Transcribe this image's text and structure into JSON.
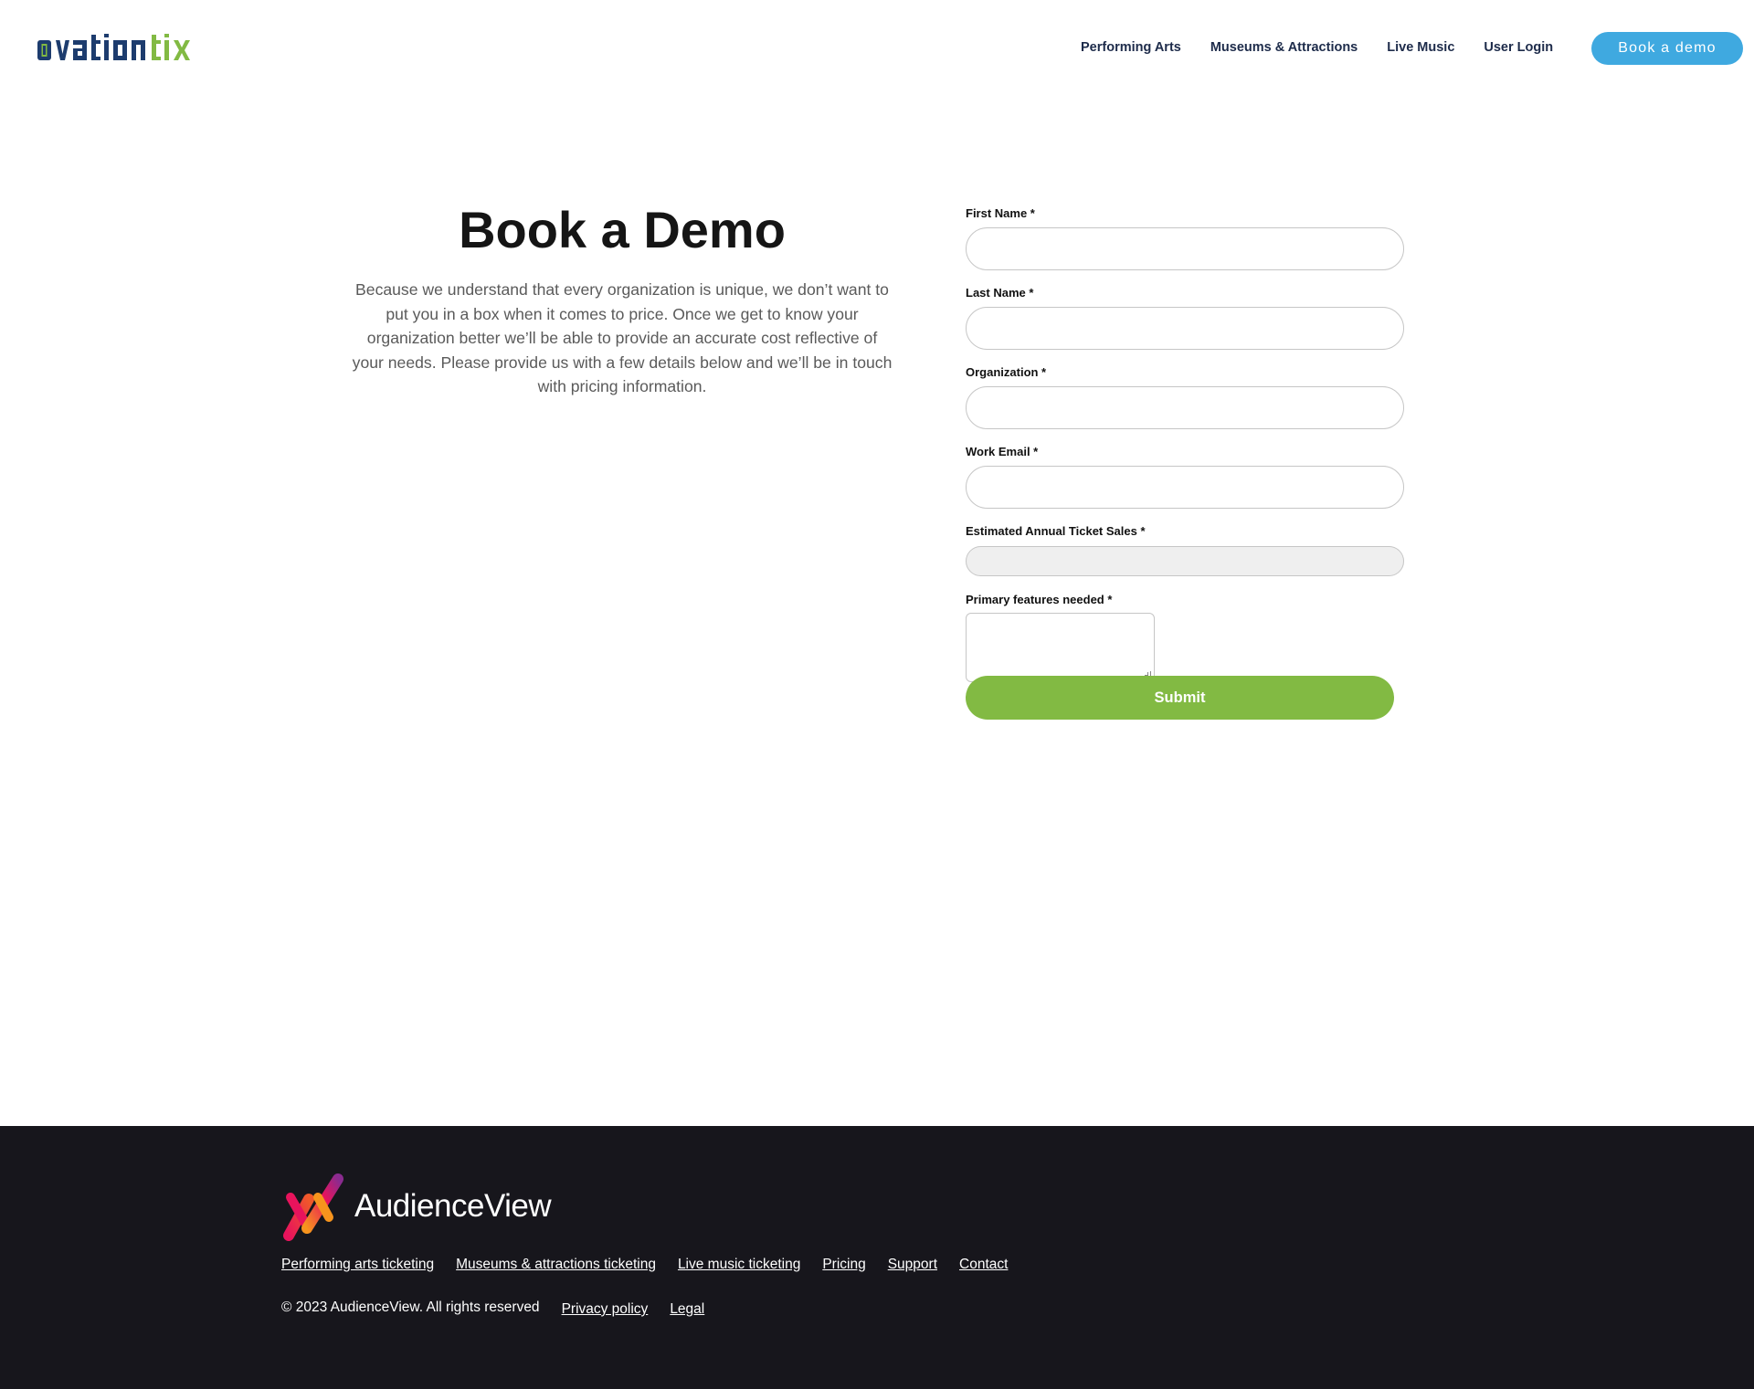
{
  "header": {
    "logo_text": "ovationtix",
    "nav": [
      {
        "label": "Performing Arts"
      },
      {
        "label": "Museums & Attractions"
      },
      {
        "label": "Live Music"
      },
      {
        "label": "User Login"
      }
    ],
    "cta_label": "Book a demo"
  },
  "intro": {
    "title": "Book a Demo",
    "body": "Because we understand that every organization is unique, we don’t want to put you in a box when it comes to price. Once we get to know your organization better we’ll be able to provide an accurate cost reflective of your needs. Please provide us with a few details below and we’ll be in touch with pricing information."
  },
  "form": {
    "fields": [
      {
        "label": "First Name *",
        "value": ""
      },
      {
        "label": "Last Name *",
        "value": ""
      },
      {
        "label": "Organization *",
        "value": ""
      },
      {
        "label": "Work Email *",
        "value": ""
      }
    ],
    "ticket_sales_label": "Estimated Annual Ticket Sales *",
    "ticket_sales_value": "",
    "features_label": "Primary features needed *",
    "features_value": "",
    "submit_label": "Submit"
  },
  "footer": {
    "logo_text": "AudienceView",
    "links": [
      {
        "label": "Performing arts ticketing"
      },
      {
        "label": "Museums & attractions ticketing"
      },
      {
        "label": "Live music ticketing"
      },
      {
        "label": "Pricing"
      },
      {
        "label": "Support"
      },
      {
        "label": "Contact"
      }
    ],
    "copyright": "© 2023 AudienceView. All rights reserved",
    "legal_links": [
      {
        "label": "Privacy policy"
      },
      {
        "label": "Legal"
      }
    ]
  },
  "colors": {
    "brand_navy": "#1d3c6e",
    "brand_green": "#82ba43",
    "cta_blue": "#3fa9e0",
    "footer_bg": "#17161c"
  }
}
